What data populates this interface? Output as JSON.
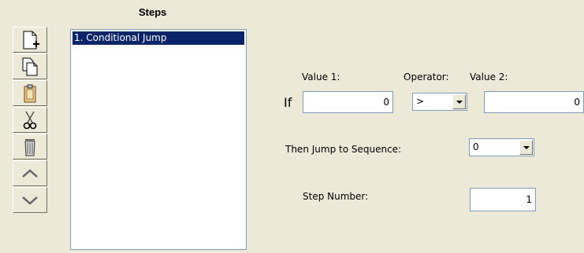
{
  "steps": {
    "title": "Steps",
    "items": [
      "1. Conditional Jump"
    ]
  },
  "toolbar": {
    "buttons": [
      {
        "icon": "new-step-icon"
      },
      {
        "icon": "copy-icon"
      },
      {
        "icon": "paste-icon"
      },
      {
        "icon": "cut-icon"
      },
      {
        "icon": "delete-icon"
      },
      {
        "icon": "move-up-icon"
      },
      {
        "icon": "move-down-icon"
      }
    ]
  },
  "condition": {
    "value1_label": "Value 1:",
    "operator_label": "Operator:",
    "value2_label": "Value 2:",
    "if_label": "If",
    "value1": "0",
    "operator": ">",
    "value2": "0"
  },
  "jump": {
    "label": "Then Jump to Sequence:",
    "sequence": "0"
  },
  "step_number": {
    "label": "Step Number:",
    "value": "1"
  },
  "colors": {
    "selection": "#0a246a",
    "panel": "#ece9d8",
    "input_border": "#7f9db9"
  }
}
